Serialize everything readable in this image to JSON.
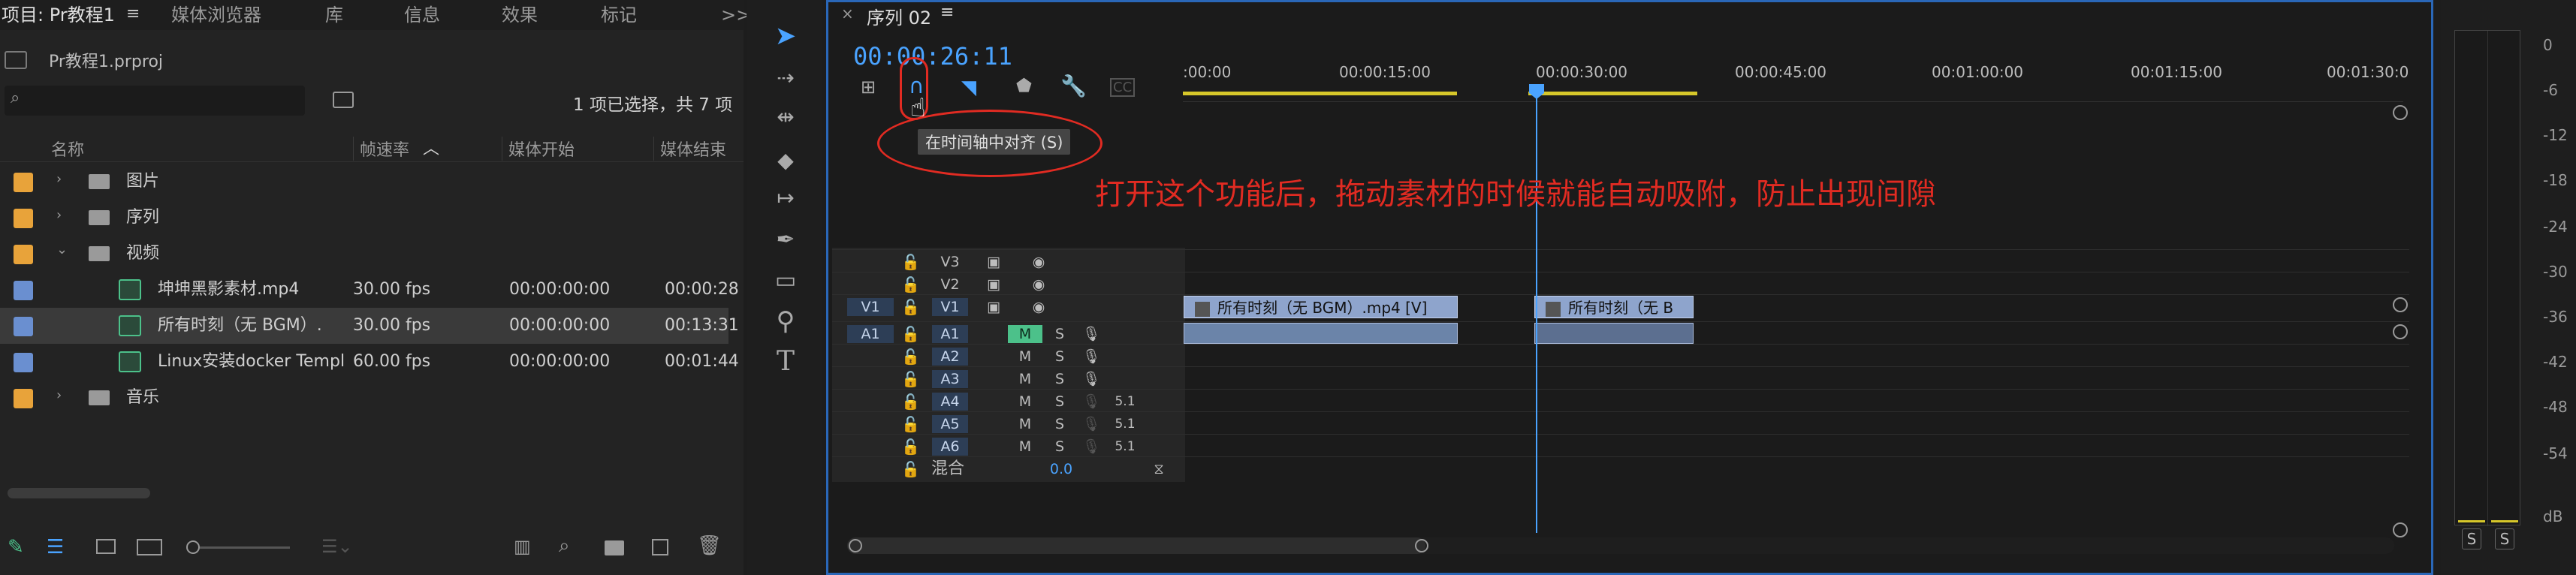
{
  "project": {
    "tabs": [
      "项目: Pr教程1",
      "媒体浏览器",
      "库",
      "信息",
      "效果",
      "标记"
    ],
    "overflow": ">>",
    "file_name": "Pr教程1.prproj",
    "search_placeholder": "",
    "selection_text": "1 项已选择，共 7 项",
    "columns": {
      "name": "名称",
      "frame_rate": "帧速率",
      "media_start": "媒体开始",
      "media_end": "媒体结束"
    },
    "items": [
      {
        "name": "图片",
        "type": "bin",
        "expanded": false,
        "color": "#e8a33a"
      },
      {
        "name": "序列",
        "type": "bin",
        "expanded": false,
        "color": "#e8a33a"
      },
      {
        "name": "视频",
        "type": "bin",
        "expanded": true,
        "color": "#e8a33a"
      },
      {
        "name": "坤坤黑影素材.mp4",
        "type": "clip",
        "frame_rate": "30.00 fps",
        "media_start": "00:00:00:00",
        "media_end": "00:00:28",
        "color": "#6a8fd0"
      },
      {
        "name": "所有时刻（无 BGM）.",
        "type": "clip",
        "frame_rate": "30.00 fps",
        "media_start": "00:00:00:00",
        "media_end": "00:13:31",
        "color": "#6a8fd0",
        "selected": true
      },
      {
        "name": "Linux安装docker Templ",
        "type": "clip",
        "frame_rate": "60.00 fps",
        "media_start": "00:00:00:00",
        "media_end": "00:01:44",
        "color": "#6a8fd0"
      },
      {
        "name": "音乐",
        "type": "bin",
        "expanded": false,
        "color": "#e8a33a"
      }
    ]
  },
  "tools": [
    "selection-tool",
    "track-select-tool",
    "ripple-edit-tool",
    "razor-tool",
    "slip-tool",
    "pen-tool",
    "rectangle-tool",
    "hand-tool",
    "zoom-tool",
    "type-tool"
  ],
  "timeline": {
    "sequence_name": "序列 02",
    "close": "×",
    "menu": "≡",
    "timecode": "00:00:26:11",
    "ruler_labels": [
      ":00:00",
      "00:00:15:00",
      "00:00:30:00",
      "00:00:45:00",
      "00:01:00:00",
      "00:01:15:00",
      "00:01:30:0"
    ],
    "tooltip": "在时间轴中对齐 (S)",
    "annotation": "打开这个功能后，拖动素材的时候就能自动吸附，防止出现间隙",
    "video_tracks": [
      "V3",
      "V2",
      "V1"
    ],
    "audio_tracks": [
      "A1",
      "A2",
      "A3",
      "A4",
      "A5",
      "A6"
    ],
    "source_v": "V1",
    "source_a": "A1",
    "mute_label": "M",
    "solo_label": "S",
    "voiceover_label": "5.1",
    "mix_label": "混合",
    "mix_value": "0.0",
    "clips": [
      {
        "label": "所有时刻（无 BGM）.mp4 [V]",
        "track": "V1"
      },
      {
        "label": "所有时刻（无 B",
        "track": "V1"
      }
    ]
  },
  "meter": {
    "scale": [
      "0",
      "-6",
      "-12",
      "-18",
      "-24",
      "-30",
      "-36",
      "-42",
      "-48",
      "-54",
      "dB"
    ],
    "solo_buttons": [
      "S",
      "S"
    ]
  },
  "colors": {
    "accent_blue": "#2a67b8",
    "timecode": "#4aa3ff",
    "annotation_red": "#e12b22",
    "bin_orange": "#e8a33a",
    "clip_blue": "#6a8fd0"
  }
}
